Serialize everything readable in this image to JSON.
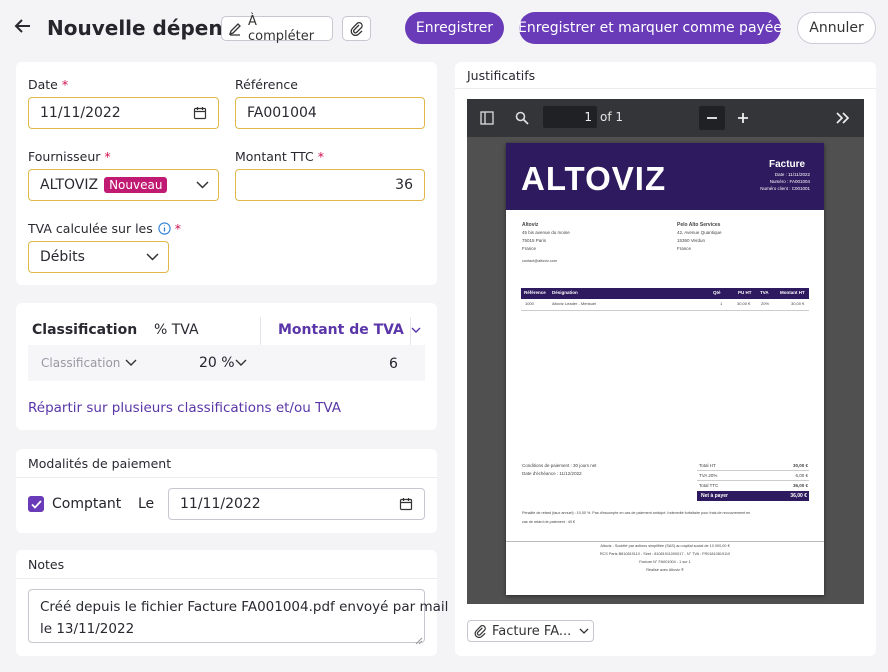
{
  "header": {
    "title": "Nouvelle dépense",
    "status_label": "À compléter",
    "save_label": "Enregistrer",
    "save_paid_label": "Enregistrer et marquer comme payée",
    "cancel_label": "Annuler"
  },
  "details": {
    "date_label": "Date",
    "date_value": "11/11/2022",
    "reference_label": "Référence",
    "reference_value": "FA001004",
    "supplier_label": "Fournisseur",
    "supplier_value": "ALTOVIZ",
    "supplier_badge": "Nouveau",
    "amount_label": "Montant TTC",
    "amount_value": "36",
    "vat_calc_label": "TVA calculée sur les",
    "vat_calc_value": "Débits",
    "required_mark": "*"
  },
  "classification": {
    "col_classification": "Classification",
    "col_vat": "% TVA",
    "col_vat_amount": "Montant de TVA",
    "row": {
      "classification_placeholder": "Classification",
      "vat_rate": "20 %",
      "vat_amount": "6"
    },
    "split_link": "Répartir sur plusieurs classifications et/ou TVA"
  },
  "payment": {
    "section_title": "Modalités de paiement",
    "cash_label": "Comptant",
    "cash_checked": true,
    "le_label": "Le",
    "date_value": "11/11/2022"
  },
  "notes": {
    "section_title": "Notes",
    "value_line1": "Créé depuis le fichier Facture FA001004.pdf envoyé par mail",
    "value_line2": "le 13/11/2022"
  },
  "attachments": {
    "section_title": "Justificatifs",
    "pdf_toolbar": {
      "page": "1",
      "of_total": "of 1"
    },
    "file_chip": "Facture FA..."
  },
  "invoice": {
    "logo": "ALTOVIZ",
    "doc_title": "Facture",
    "meta": [
      "Date : 11/11/2022",
      "Numéro : FA001004",
      "Numéro client : C001001"
    ],
    "seller": [
      "Altoviz",
      "45 bis avenue du moine",
      "75015 Paris",
      "France",
      "contact@altoviz.com"
    ],
    "buyer": [
      "Pelo Alto Services",
      "42, Avenue Quantique",
      "15360 Verdun",
      "France"
    ],
    "table_headers": [
      "Référence",
      "Désignation",
      "Qté",
      "PU HT",
      "TVA",
      "Montant HT"
    ],
    "table_row": [
      "1000",
      "Altoviz Leader - Mensuel",
      "1",
      "30,00 €",
      "20%",
      "30,00 €"
    ],
    "conditions": [
      "Conditions de paiement : 30 jours net",
      "Date d'échéance : 11/12/2022"
    ],
    "totals": [
      [
        "Total HT",
        "30,00 €"
      ],
      [
        "TVA 20%",
        "6,00 €"
      ],
      [
        "Total TTC",
        "36,00 €"
      ]
    ],
    "net_label": "Net à payer",
    "net_value": "36,00 €",
    "penalty": [
      "Pénalité de retard (taux annuel) : 10,00 %. Pas d'escompte en cas de paiement anticipé. Indemnité forfaitaire pour frais de recouvrement en",
      "cas de retard de paiement : 40 €"
    ],
    "footer": [
      "Altoviz - Société par actions simplifiée (SAS) au capital social de 10 000,00 €",
      "RCS Paris B810819110 - Siret : 81081911000017 - N° TVA : FR01810819110",
      "Facture N° FA001004 - 1 sur 1",
      "Réalisé avec Altoviz ®"
    ]
  },
  "colors": {
    "primary": "#6a3bb8",
    "field_border": "#e0b94a",
    "badge": "#c01a73",
    "invoice_header": "#2e1a5e"
  }
}
